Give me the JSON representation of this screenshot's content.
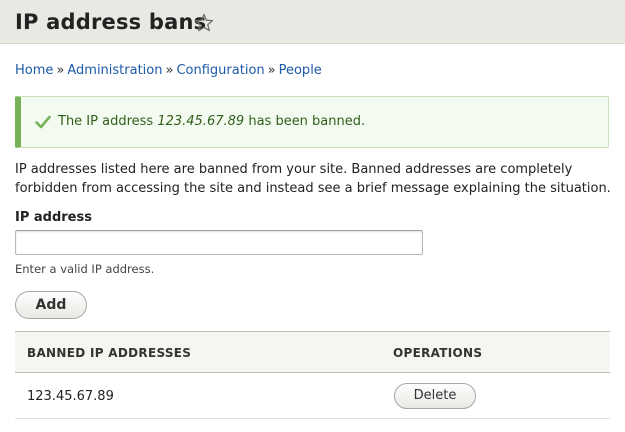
{
  "header": {
    "title": "IP address bans",
    "shortcut_icon": "star-outline-icon"
  },
  "breadcrumb": {
    "items": [
      "Home",
      "Administration",
      "Configuration",
      "People"
    ],
    "separator": "»"
  },
  "status": {
    "icon": "check-icon",
    "text_before": "The IP address",
    "ip": "123.45.67.89",
    "text_after": "has been banned.",
    "accent_color": "#77b259"
  },
  "description": "IP addresses listed here are banned from your site. Banned addresses are completely forbidden from accessing the site and instead see a brief message explaining the situation.",
  "form": {
    "ip_label": "IP address",
    "ip_value": "",
    "ip_help": "Enter a valid IP address.",
    "add_label": "Add"
  },
  "table": {
    "headers": [
      "BANNED IP ADDRESSES",
      "OPERATIONS"
    ],
    "rows": [
      {
        "ip": "123.45.67.89",
        "operation": "Delete"
      }
    ]
  },
  "colors": {
    "link": "#1d5ba8",
    "header_bg": "#e9e9e4"
  }
}
